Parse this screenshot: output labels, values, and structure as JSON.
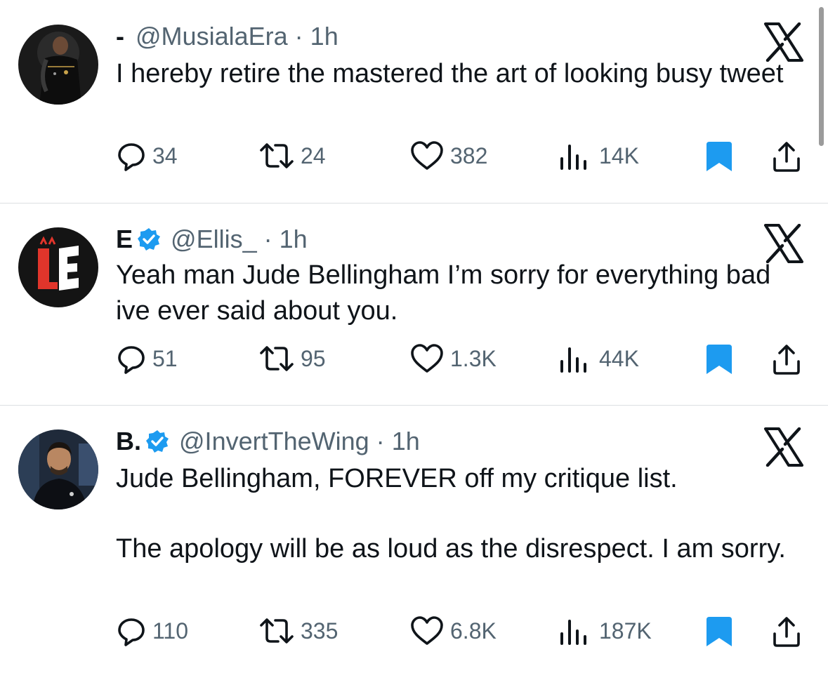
{
  "tweets": [
    {
      "display_name": "-",
      "handle": "@MusialaEra",
      "time": "1h",
      "verified": false,
      "body": [
        "I hereby retire the mastered the art of looking busy tweet"
      ],
      "replies": "34",
      "retweets": "24",
      "likes": "382",
      "views": "14K"
    },
    {
      "display_name": "E",
      "handle": "@Ellis_",
      "time": "1h",
      "verified": true,
      "body": [
        "Yeah man Jude Bellingham I’m sorry for everything bad ive ever said about you."
      ],
      "replies": "51",
      "retweets": "95",
      "likes": "1.3K",
      "views": "44K"
    },
    {
      "display_name": "B.",
      "handle": "@InvertTheWing",
      "time": "1h",
      "verified": true,
      "body": [
        "Jude Bellingham, FOREVER off my critique list.",
        "The apology will be as loud as the disrespect. I am sorry."
      ],
      "replies": "110",
      "retweets": "335",
      "likes": "6.8K",
      "views": "187K"
    }
  ],
  "separator": "·",
  "colors": {
    "text": "#0f1419",
    "secondary": "#536471",
    "verified": "#1d9bf0",
    "bookmark": "#1d9bf0",
    "divider": "#dcdfe2"
  },
  "icons": [
    "x-logo-icon",
    "verified-badge-icon",
    "reply-icon",
    "retweet-icon",
    "like-icon",
    "views-icon",
    "bookmark-icon",
    "share-icon"
  ]
}
